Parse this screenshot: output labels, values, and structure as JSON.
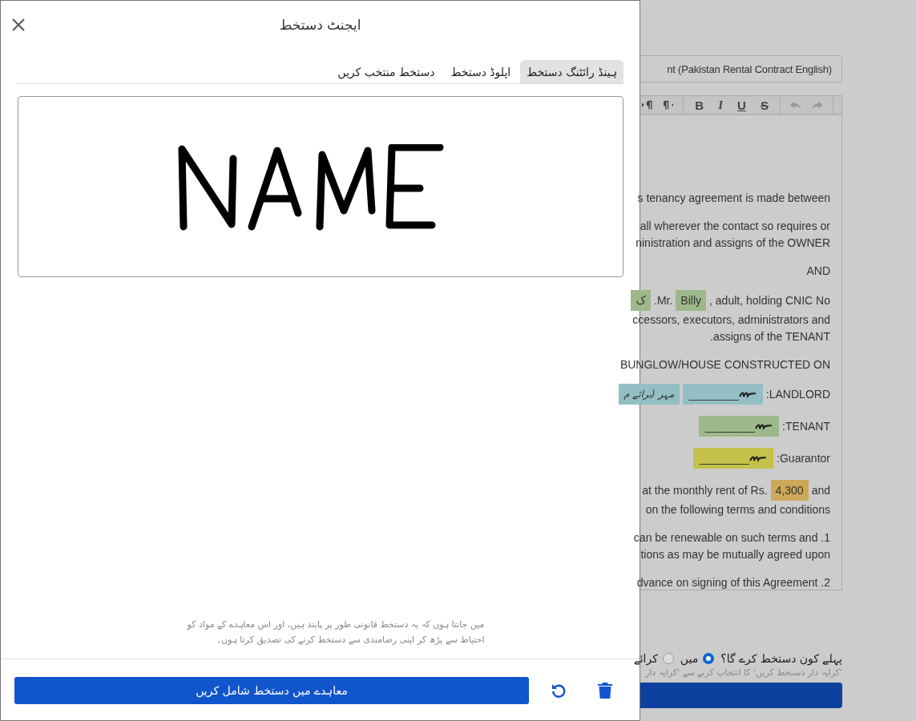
{
  "modal": {
    "title": "ایجنٹ دستخط",
    "tabs": [
      {
        "label": "ہینڈ رائٹنگ دستخط",
        "selected": true
      },
      {
        "label": "اپلوڈ دستخط",
        "selected": false
      },
      {
        "label": "دستخط منتخب کریں",
        "selected": false
      }
    ],
    "consent": "میں جانتا ہوں کہ یہ دستخط قانونی طور پر پابند ہیں، اور اس معاہدے کے مواد کو احتیاط سے پڑھ کر اپنی رضامندی سے دستخط کرنے کی تصدیق کرتا ہوں۔",
    "add_button": "معاہدے میں دستخط شامل کریں"
  },
  "document": {
    "title_field": "nt (Pakistan Rental Contract English)",
    "toolbar": [
      {
        "kind": "divider"
      },
      {
        "kind": "redo"
      },
      {
        "kind": "undo"
      },
      {
        "kind": "divider"
      },
      {
        "kind": "strike",
        "label": "S"
      },
      {
        "kind": "underline",
        "label": "U"
      },
      {
        "kind": "italic",
        "label": "I"
      },
      {
        "kind": "bold",
        "label": "B"
      },
      {
        "kind": "divider"
      },
      {
        "kind": "rtl"
      },
      {
        "kind": "ltr"
      }
    ],
    "paragraphs": [
      [
        [
          {
            "kind": "text",
            "text": "s tenancy agreement is made between"
          }
        ]
      ],
      [
        [
          {
            "kind": "text",
            "text": "all wherever the contact so requires or"
          }
        ],
        [
          {
            "kind": "text",
            "text": "ninistration and assigns of the OWNER"
          }
        ]
      ],
      [
        [
          {
            "kind": "text",
            "text": "AND"
          }
        ]
      ],
      [
        [
          {
            "kind": "text",
            "text": ", adult, holding CNIC No"
          },
          {
            "kind": "field",
            "text": "Billy",
            "color": "#9db88a"
          },
          {
            "kind": "text",
            "text": ".Mr."
          },
          {
            "kind": "field",
            "text": "ک",
            "color": "#9db88a"
          }
        ],
        [
          {
            "kind": "text",
            "text": "ccessors, executors, administrators and"
          }
        ],
        [
          {
            "kind": "text",
            "text": ".assigns of the TENANT"
          }
        ]
      ],
      [
        [
          {
            "kind": "text",
            "text": "BUNGLOW/HOUSE CONSTRUCTED ON"
          }
        ]
      ],
      [
        [
          {
            "kind": "text",
            "text": ":LANDLORD"
          },
          {
            "kind": "signature",
            "text": "________",
            "color": "#93bfc4"
          },
          {
            "kind": "stamp",
            "text": "مہر (برائے م",
            "color": "#93bfc4"
          }
        ]
      ],
      [
        [
          {
            "kind": "text",
            "text": ":TENANT"
          },
          {
            "kind": "signature",
            "text": "________",
            "color": "#9db88a"
          }
        ]
      ],
      [
        [
          {
            "kind": "text",
            "text": ":Guarantor"
          },
          {
            "kind": "signature",
            "text": "________",
            "color": "#c4c24a"
          }
        ]
      ],
      [
        [
          {
            "kind": "text",
            "text": "and"
          },
          {
            "kind": "field",
            "text": "4,300",
            "color": "#cda858"
          },
          {
            "kind": "text",
            "text": "at the monthly rent of Rs."
          }
        ],
        [
          {
            "kind": "text",
            "text": "on the following terms and conditions"
          }
        ]
      ],
      [
        [
          {
            "kind": "text",
            "text": "can be renewable on such terms and .1"
          }
        ],
        [
          {
            "kind": "text",
            "text": "tions as may be mutually agreed upon"
          }
        ]
      ],
      [
        [
          {
            "kind": "text",
            "text": "dvance on signing of this Agreement .2"
          }
        ]
      ]
    ],
    "question": "پہلے کون دستخط کرے گا؟",
    "options": [
      {
        "label": "میں",
        "selected": true
      },
      {
        "label": "کرائے",
        "selected": false
      }
    ],
    "hint": "'کرایہ دار دستخط کریں' کا انتخاب کرنے سے 'کرایہ دار"
  }
}
